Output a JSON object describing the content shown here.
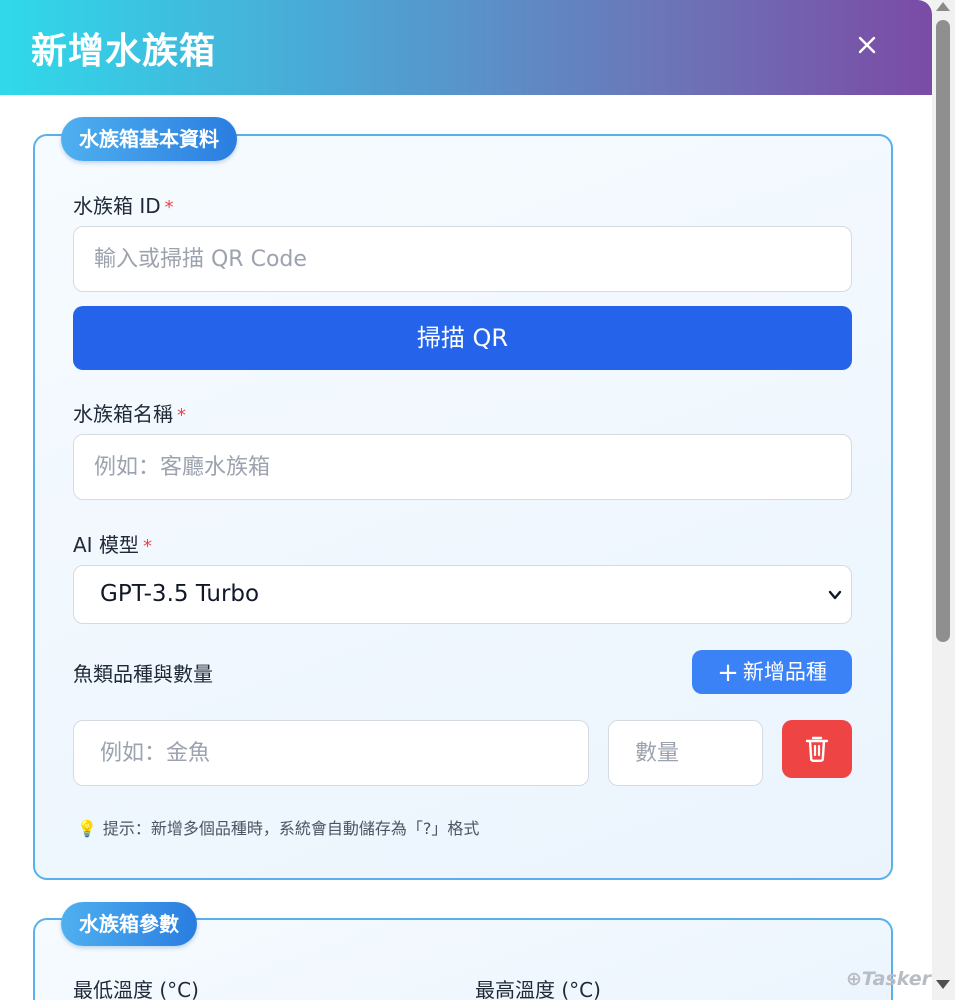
{
  "modal": {
    "title": "新增水族箱",
    "close_icon": "close-icon"
  },
  "basic_section": {
    "legend": "水族箱基本資料",
    "tank_id": {
      "label": "水族箱 ID",
      "required_mark": "*",
      "placeholder": "輸入或掃描 QR Code",
      "value": ""
    },
    "scan_button": "掃描 QR",
    "tank_name": {
      "label": "水族箱名稱",
      "required_mark": "*",
      "placeholder": "例如：客廳水族箱",
      "value": ""
    },
    "ai_model": {
      "label": "AI 模型",
      "required_mark": "*",
      "selected": "GPT-3.5 Turbo",
      "icon": "chevron-down-icon"
    },
    "fish": {
      "label": "魚類品種與數量",
      "add_button_plus": "+",
      "add_button": "新增品種",
      "species_placeholder": "例如：金魚",
      "quantity_placeholder": "數量",
      "delete_icon": "trash-icon"
    },
    "hint_icon": "💡",
    "hint": "提示：新增多個品種時，系統會自動儲存為「?」格式"
  },
  "params_section": {
    "legend": "水族箱參數",
    "min_temp_label": "最低溫度 (°C)",
    "max_temp_label": "最高溫度 (°C)"
  },
  "watermark": "Tasker",
  "colors": {
    "primary": "#2563eb",
    "accent_blue": "#3b82f6",
    "danger": "#ef4444",
    "section_border": "#5ab0ec"
  }
}
